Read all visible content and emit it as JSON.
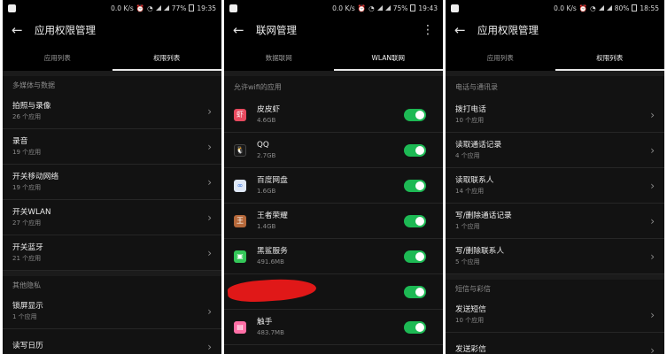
{
  "screens": [
    {
      "status": {
        "left_icons": [
          "app-badge-icon",
          "small-app-icon"
        ],
        "net": "0.0 K/s",
        "battery": "77%",
        "time": "19:35"
      },
      "appbar": {
        "title": "应用权限管理"
      },
      "tabs": [
        {
          "label": "应用列表"
        },
        {
          "label": "权限列表"
        }
      ],
      "sections": [
        {
          "header": "多媒体与数据",
          "items": [
            {
              "label": "拍照与录像",
              "sub": "26 个应用"
            },
            {
              "label": "录音",
              "sub": "19 个应用"
            },
            {
              "label": "开关移动网络",
              "sub": "19 个应用"
            },
            {
              "label": "开关WLAN",
              "sub": "27 个应用"
            },
            {
              "label": "开关蓝牙",
              "sub": "21 个应用"
            }
          ]
        },
        {
          "header": "其他隐私",
          "items": [
            {
              "label": "锁屏显示",
              "sub": "1 个应用"
            },
            {
              "label": "读写日历",
              "sub": ""
            }
          ]
        }
      ]
    },
    {
      "status": {
        "net": "0.0 K/s",
        "battery": "75%",
        "time": "19:43"
      },
      "appbar": {
        "title": "联网管理"
      },
      "tabs": [
        {
          "label": "数据联网"
        },
        {
          "label": "WLAN联网"
        }
      ],
      "section_header": "允许wifi的应用",
      "apps": [
        {
          "name": "皮皮虾",
          "size": "4.6GB",
          "icon": "pipixia-icon",
          "color": "#e84a5f",
          "toggle": true
        },
        {
          "name": "QQ",
          "size": "2.7GB",
          "icon": "qq-penguin-icon",
          "color": "#1a1a1a",
          "toggle": true
        },
        {
          "name": "百度网盘",
          "size": "1.6GB",
          "icon": "baidu-netdisk-icon",
          "color": "#dfe8f7",
          "toggle": true
        },
        {
          "name": "王者荣耀",
          "size": "1.4GB",
          "icon": "honor-of-kings-icon",
          "color": "#b5683a",
          "toggle": true
        },
        {
          "name": "黑鲨服务",
          "size": "491.6MB",
          "icon": "blackshark-service-icon",
          "color": "#34c759",
          "toggle": true
        },
        {
          "name": "",
          "size": "",
          "icon": "redacted-app-icon",
          "color": "#121212",
          "toggle": true
        },
        {
          "name": "触手",
          "size": "483.7MB",
          "icon": "chushou-icon",
          "color": "#ff6fa6",
          "toggle": true
        }
      ]
    },
    {
      "status": {
        "net": "0.0 K/s",
        "battery": "80%",
        "time": "18:55"
      },
      "appbar": {
        "title": "应用权限管理"
      },
      "tabs": [
        {
          "label": "应用列表"
        },
        {
          "label": "权限列表"
        }
      ],
      "sections": [
        {
          "header": "电话与通讯录",
          "items": [
            {
              "label": "拨打电话",
              "sub": "10 个应用"
            },
            {
              "label": "读取通话记录",
              "sub": "4 个应用"
            },
            {
              "label": "读取联系人",
              "sub": "14 个应用"
            },
            {
              "label": "写/删除通话记录",
              "sub": "1 个应用"
            },
            {
              "label": "写/删除联系人",
              "sub": "5 个应用"
            }
          ]
        },
        {
          "header": "短信与彩信",
          "items": [
            {
              "label": "发送短信",
              "sub": "10 个应用"
            },
            {
              "label": "发送彩信",
              "sub": ""
            }
          ]
        }
      ]
    }
  ]
}
